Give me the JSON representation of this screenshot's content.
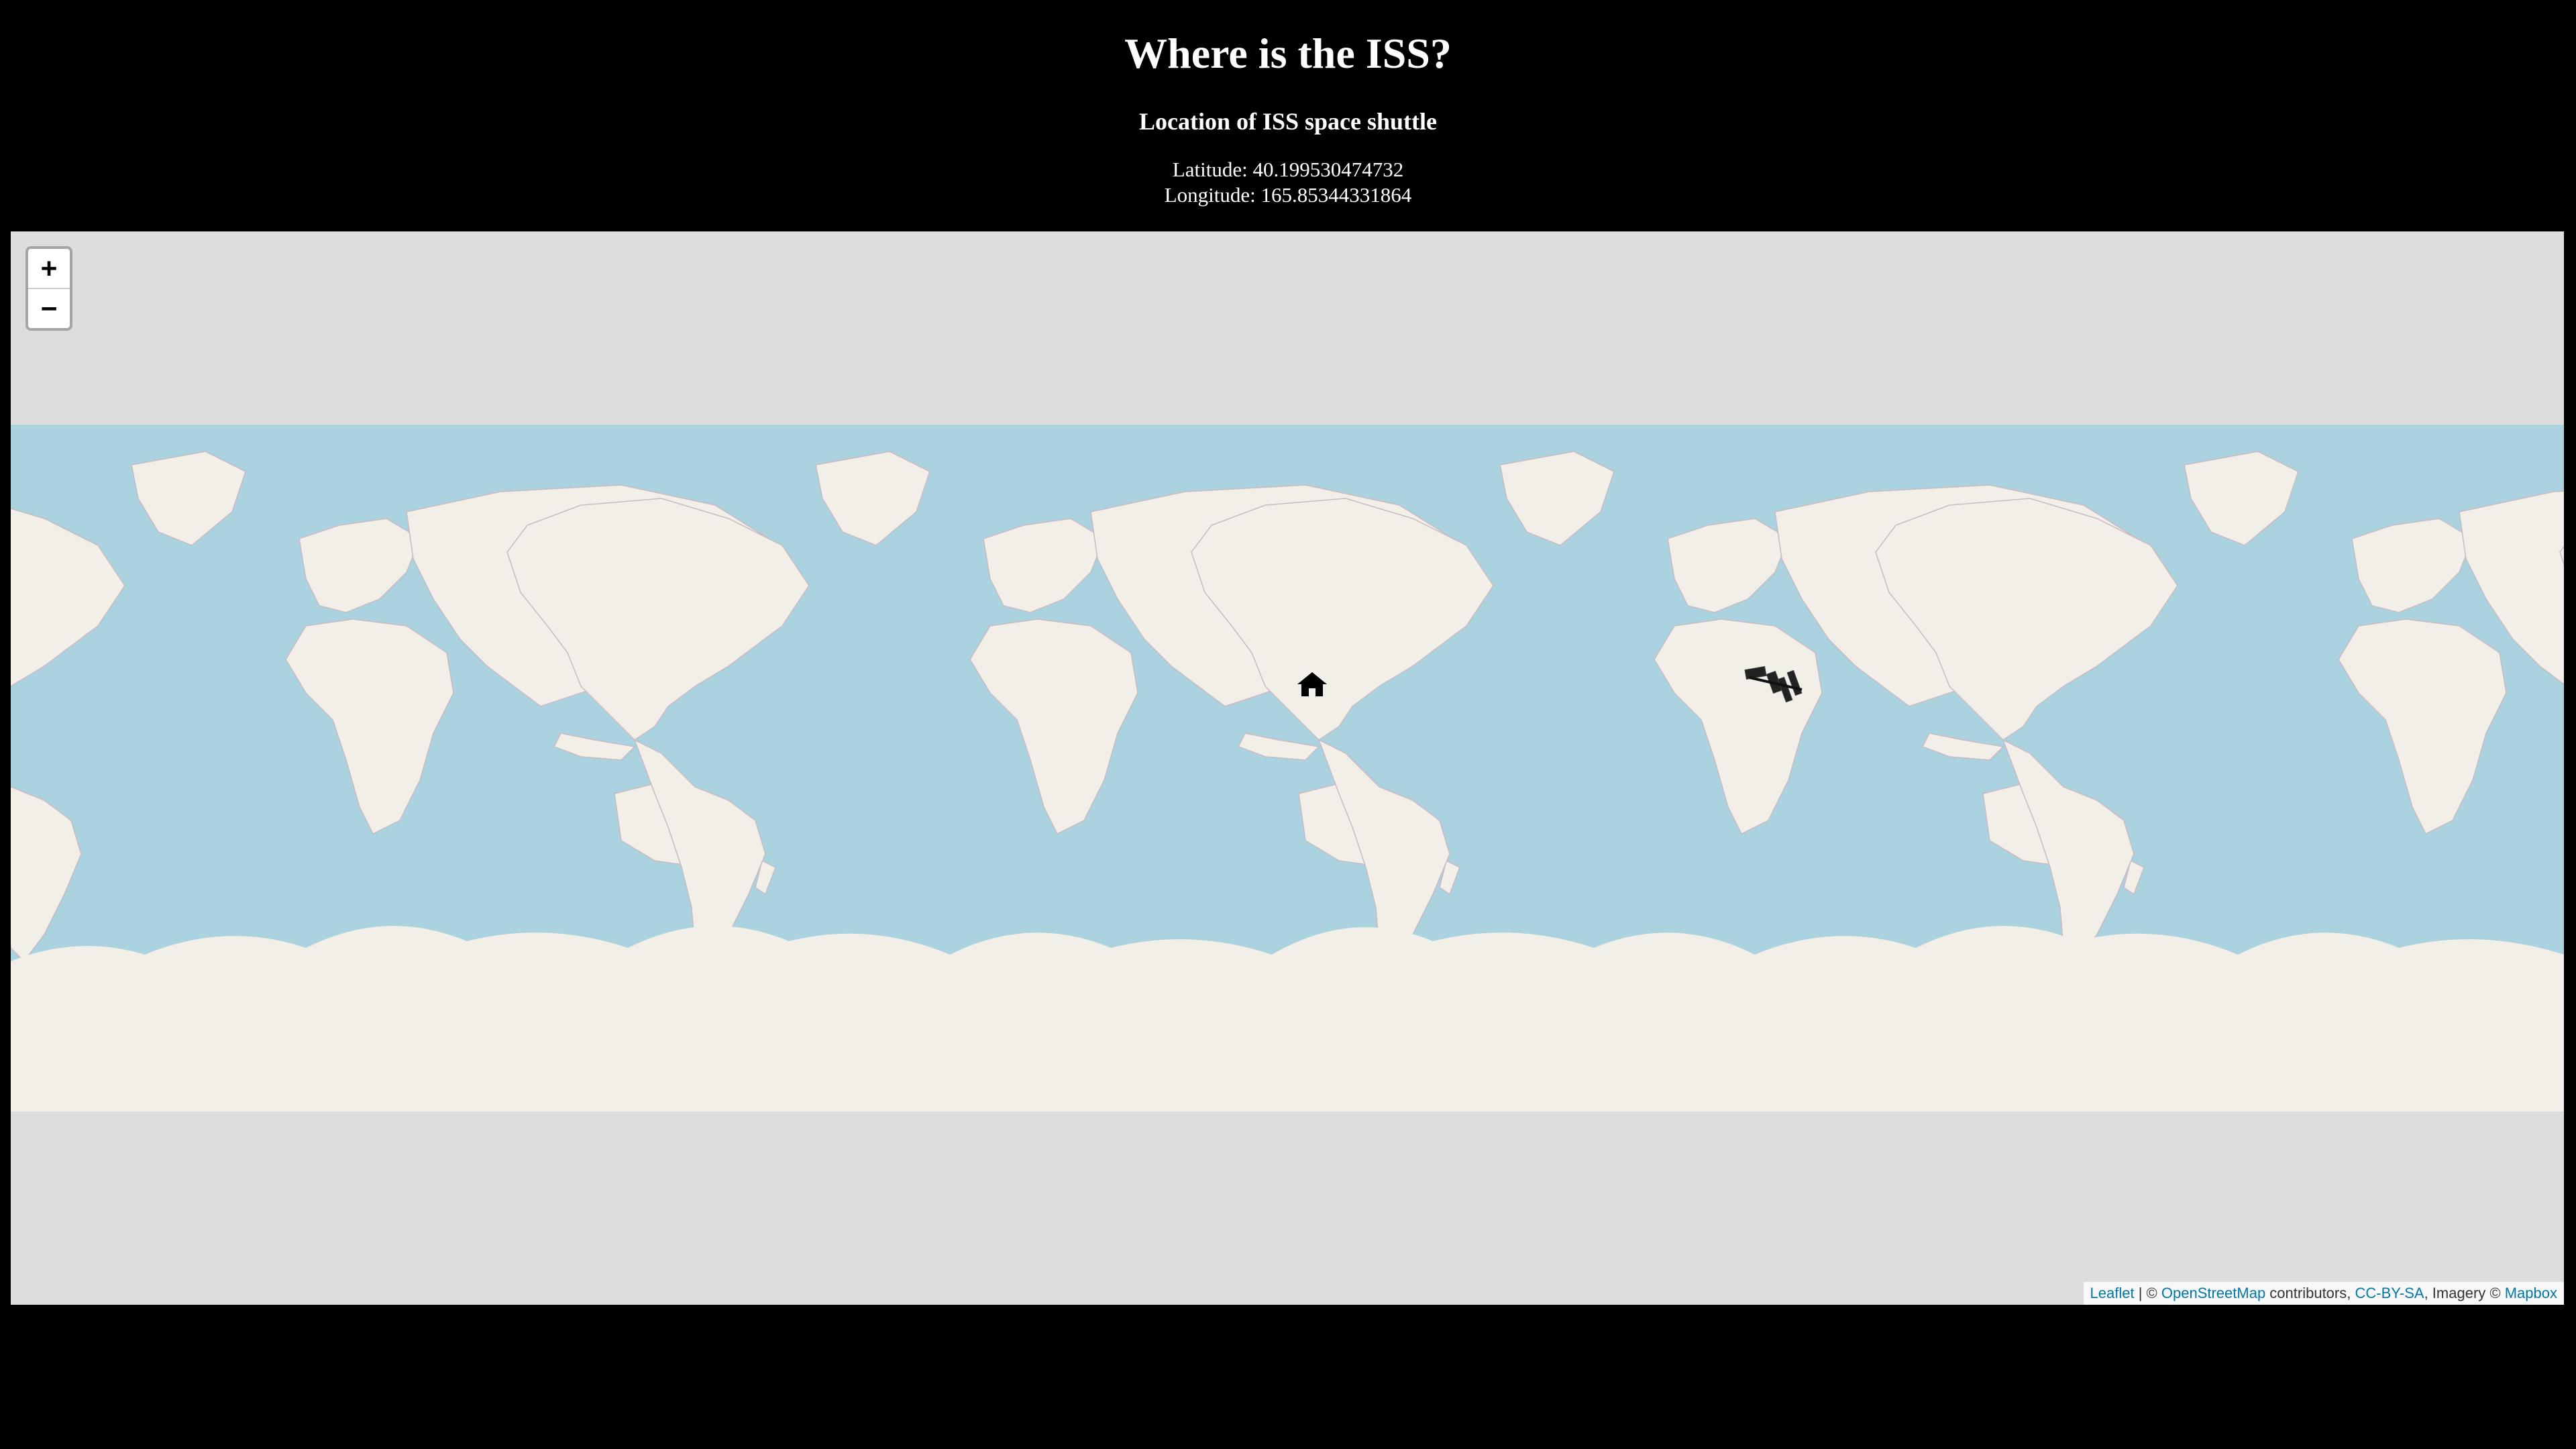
{
  "page": {
    "title": "Where is the ISS?",
    "subtitle": "Location of ISS space shuttle",
    "latitude_label": "Latitude: 40.199530474732",
    "longitude_label": "Longitude: 165.85344331864"
  },
  "iss": {
    "latitude": 40.199530474732,
    "longitude": 165.85344331864
  },
  "map": {
    "zoom_in": "+",
    "zoom_out": "−",
    "colors": {
      "ocean": "#aad3df",
      "land": "#f2efe9",
      "background": "#dddddd"
    },
    "markers": [
      {
        "name": "home-icon",
        "latitude": 40.2,
        "longitude": -77.5
      },
      {
        "name": "iss-icon",
        "latitude": 40.199530474732,
        "longitude": 165.85344331864
      }
    ],
    "attribution": {
      "leaflet": "Leaflet",
      "sep1": " | © ",
      "osm": "OpenStreetMap",
      "contributors": " contributors, ",
      "license": "CC-BY-SA",
      "imagery": ", Imagery © ",
      "mapbox": "Mapbox"
    }
  }
}
